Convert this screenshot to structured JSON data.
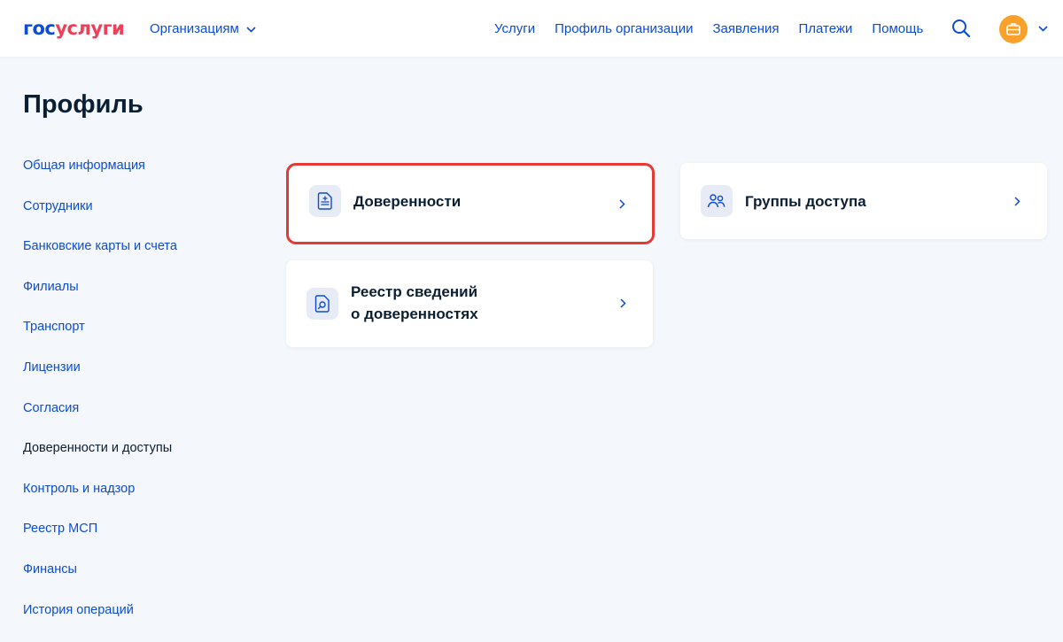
{
  "header": {
    "logo_part1": "гос",
    "logo_part2": "услуги",
    "org_menu_label": "Организациям",
    "nav": [
      "Услуги",
      "Профиль организации",
      "Заявления",
      "Платежи",
      "Помощь"
    ]
  },
  "page": {
    "title": "Профиль"
  },
  "sidebar": {
    "items": [
      {
        "label": "Общая информация"
      },
      {
        "label": "Сотрудники"
      },
      {
        "label": "Банковские карты и счета"
      },
      {
        "label": "Филиалы"
      },
      {
        "label": "Транспорт"
      },
      {
        "label": "Лицензии"
      },
      {
        "label": "Согласия"
      },
      {
        "label": "Доверенности и доступы",
        "active": true
      },
      {
        "label": "Контроль и надзор"
      },
      {
        "label": "Реестр МСП"
      },
      {
        "label": "Финансы"
      },
      {
        "label": "История операций"
      }
    ]
  },
  "cards": [
    {
      "title": "Доверенности",
      "icon": "document-icon",
      "highlighted": true
    },
    {
      "title": "Группы доступа",
      "icon": "people-icon"
    },
    {
      "title_line1": "Реестр сведений",
      "title_line2": "о доверенностях",
      "icon": "document-search-icon"
    }
  ],
  "colors": {
    "link": "#0d4cd3",
    "logo_red": "#ee3f58",
    "highlight": "#e53935",
    "avatar": "#f9a12a",
    "background": "#f4f7fc"
  }
}
